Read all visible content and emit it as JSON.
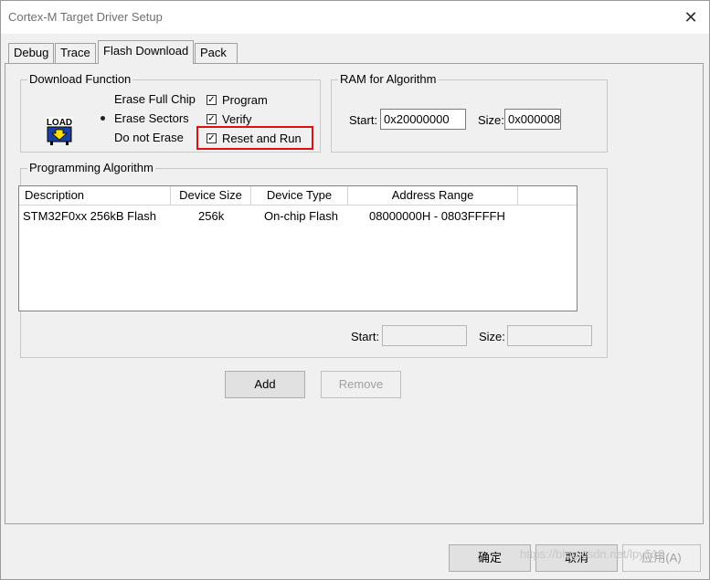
{
  "window": {
    "title": "Cortex-M Target Driver Setup"
  },
  "tabs": [
    {
      "label": "Debug"
    },
    {
      "label": "Trace"
    },
    {
      "label": "Flash Download"
    },
    {
      "label": "Pack"
    }
  ],
  "download_function": {
    "label": "Download Function",
    "icon_text": "LOAD",
    "erase_options": [
      {
        "label": "Erase Full Chip",
        "selected": false
      },
      {
        "label": "Erase Sectors",
        "selected": true
      },
      {
        "label": "Do not Erase",
        "selected": false
      }
    ],
    "checks": [
      {
        "label": "Program",
        "checked": true
      },
      {
        "label": "Verify",
        "checked": true
      },
      {
        "label": "Reset and Run",
        "checked": true
      }
    ],
    "highlight_color": "#e01010"
  },
  "ram": {
    "label": "RAM for Algorithm",
    "start_label": "Start:",
    "start_value": "0x20000000",
    "size_label": "Size:",
    "size_value": "0x000008"
  },
  "programming_algorithm": {
    "label": "Programming Algorithm",
    "columns": [
      "Description",
      "Device Size",
      "Device Type",
      "Address Range"
    ],
    "rows": [
      {
        "description": "STM32F0xx 256kB Flash",
        "size": "256k",
        "type": "On-chip Flash",
        "range": "08000000H - 0803FFFFH"
      }
    ],
    "start_label": "Start:",
    "size_label": "Size:"
  },
  "buttons": {
    "add": "Add",
    "remove": "Remove",
    "ok": "确定",
    "cancel": "取消",
    "apply": "应用(A)"
  },
  "watermark": "https://blog.csdn.net/lpy518"
}
